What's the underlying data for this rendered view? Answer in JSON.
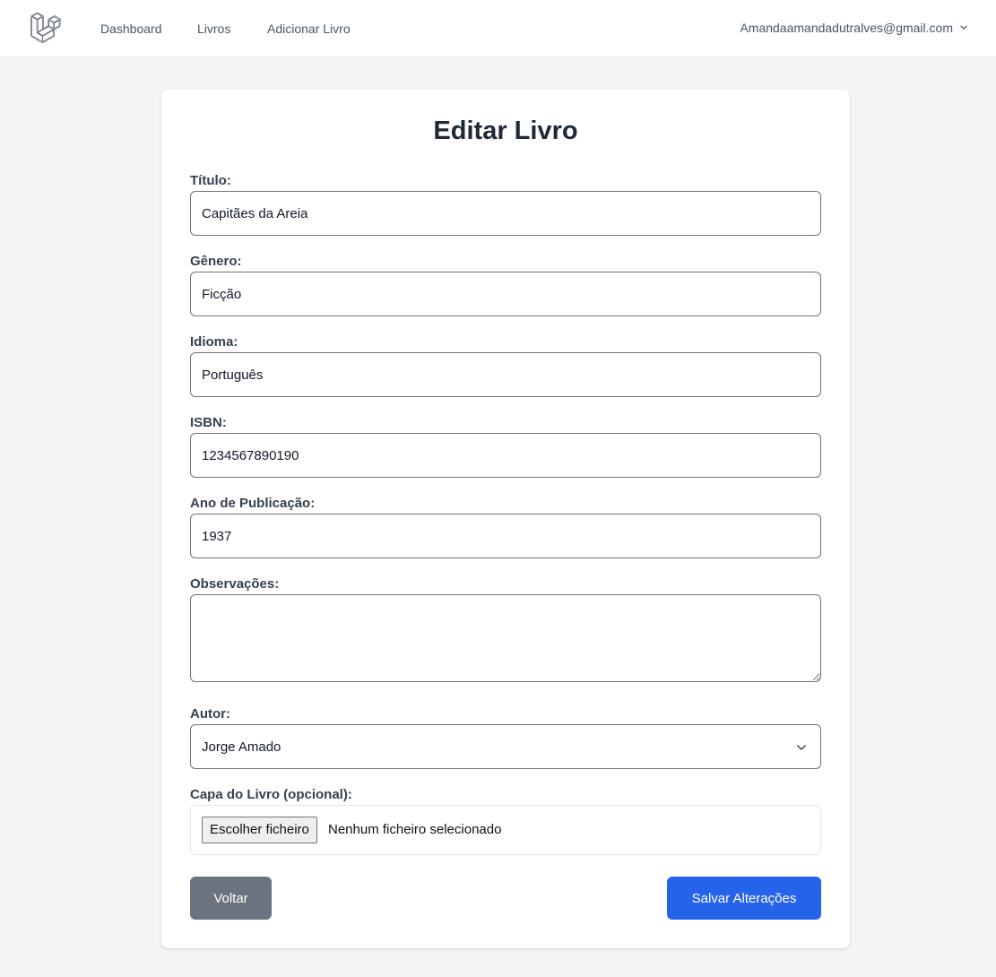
{
  "nav": {
    "links": [
      "Dashboard",
      "Livros",
      "Adicionar Livro"
    ],
    "user_email": "Amandaamandadutralves@gmail.com"
  },
  "form": {
    "title": "Editar Livro",
    "fields": {
      "titulo": {
        "label": "Título:",
        "value": "Capitães da Areia"
      },
      "genero": {
        "label": "Gênero:",
        "value": "Ficção"
      },
      "idioma": {
        "label": "Idioma:",
        "value": "Português"
      },
      "isbn": {
        "label": "ISBN:",
        "value": "1234567890190"
      },
      "ano": {
        "label": "Ano de Publicação:",
        "value": "1937"
      },
      "observacoes": {
        "label": "Observações:",
        "value": ""
      },
      "autor": {
        "label": "Autor:",
        "value": "Jorge Amado"
      },
      "capa": {
        "label": "Capa do Livro (opcional):",
        "button": "Escolher ficheiro",
        "status": "Nenhum ficheiro selecionado"
      }
    },
    "buttons": {
      "back": "Voltar",
      "save": "Salvar Alterações"
    }
  },
  "colors": {
    "primary": "#2563eb",
    "secondary": "#6b7280",
    "background": "#f3f4f6"
  }
}
